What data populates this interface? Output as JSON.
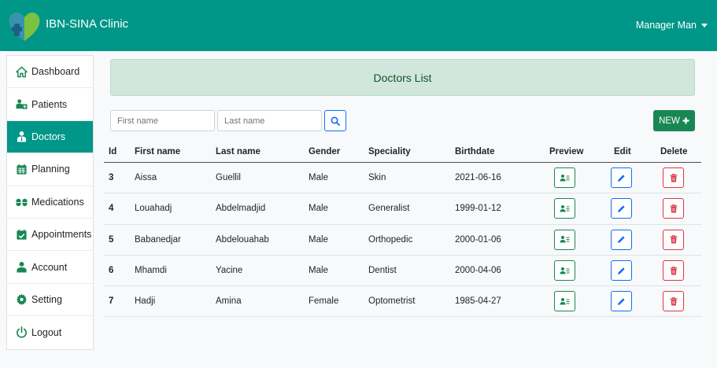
{
  "app": {
    "brand": "IBN-SINA Clinic",
    "user": "Manager Man"
  },
  "sidebar": {
    "items": [
      {
        "label": "Dashboard",
        "icon": "home-icon"
      },
      {
        "label": "Patients",
        "icon": "users-icon"
      },
      {
        "label": "Doctors",
        "icon": "doctor-icon"
      },
      {
        "label": "Planning",
        "icon": "calendar-icon"
      },
      {
        "label": "Medications",
        "icon": "pills-icon"
      },
      {
        "label": "Appointments",
        "icon": "calendar-check-icon"
      },
      {
        "label": "Account",
        "icon": "user-icon"
      },
      {
        "label": "Setting",
        "icon": "gear-icon"
      },
      {
        "label": "Logout",
        "icon": "power-icon"
      }
    ],
    "active": "Doctors"
  },
  "main": {
    "title": "Doctors List",
    "search": {
      "first_placeholder": "First name",
      "last_placeholder": "Last name"
    },
    "new_label": "NEW"
  },
  "table": {
    "headers": [
      "Id",
      "First name",
      "Last name",
      "Gender",
      "Speciality",
      "Birthdate",
      "Preview",
      "Edit",
      "Delete"
    ],
    "rows": [
      [
        "3",
        "Aissa",
        "Guellil",
        "Male",
        "Skin",
        "2021-06-16"
      ],
      [
        "4",
        "Louahadj",
        "Abdelmadjid",
        "Male",
        "Generalist",
        "1999-01-12"
      ],
      [
        "5",
        "Babanedjar",
        "Abdelouahab",
        "Male",
        "Orthopedic",
        "2000-01-06"
      ],
      [
        "6",
        "Mhamdi",
        "Yacine",
        "Male",
        "Dentist",
        "2000-04-06"
      ],
      [
        "7",
        "Hadji",
        "Amina",
        "Female",
        "Optometrist",
        "1985-04-27"
      ]
    ]
  },
  "colors": {
    "navbar": "#009688",
    "active": "#009688",
    "title_bg": "#d1e7dd",
    "new_button": "#198754",
    "preview": "#198754",
    "edit": "#0d6efd",
    "delete": "#dc3545"
  }
}
